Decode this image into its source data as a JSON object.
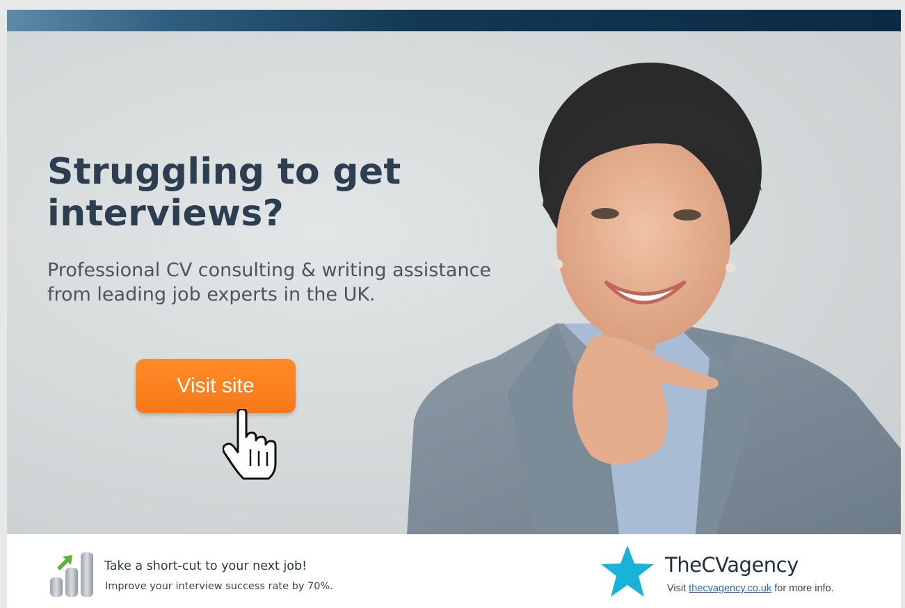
{
  "ad": {
    "headline": "Struggling to get interviews?",
    "subheadline": "Professional CV consulting & writing assistance from leading job experts in the UK.",
    "cta_label": "Visit site",
    "colors": {
      "top_bar": "#0b2a44",
      "cta": "#f7791a",
      "headline": "#2c3e50",
      "star": "#18b3d8",
      "link": "#2a63c5"
    },
    "icons": {
      "cursor": "hand-pointer-icon",
      "chart": "bar-chart-arrow-icon",
      "star": "star-icon"
    }
  },
  "footer": {
    "tagline": "Take a short-cut to your next job!",
    "subtagline": "Improve your interview success rate by 70%.",
    "brand": "TheCVagency",
    "visit_prefix": "Visit",
    "link_text": "thecvagency.co.uk",
    "visit_suffix": "for more info."
  }
}
